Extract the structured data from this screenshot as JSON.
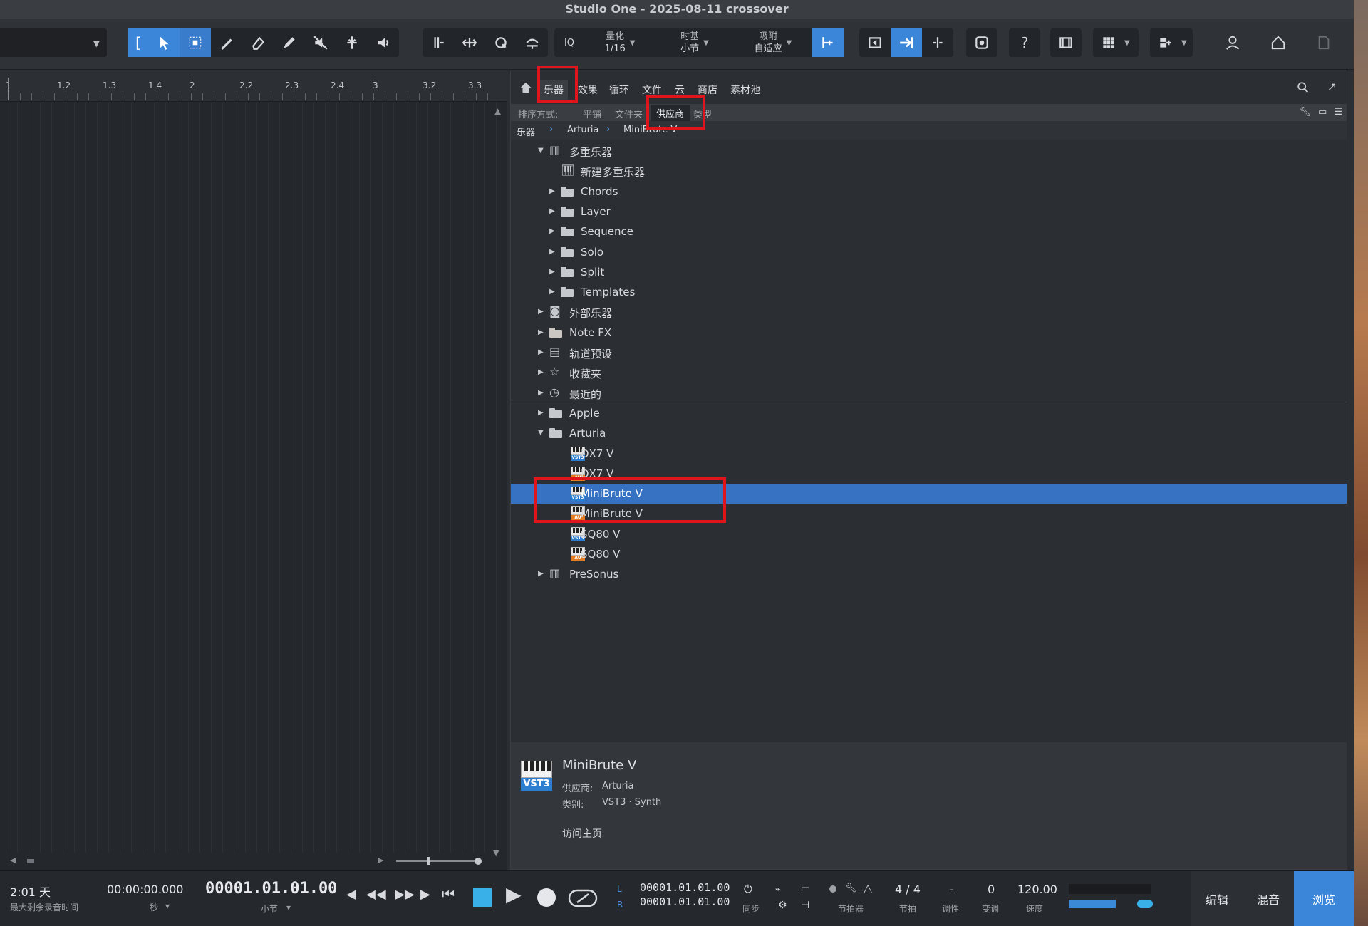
{
  "window": {
    "title": "Studio One - 2025-08-11 crossover"
  },
  "toolbar": {
    "iq_label": "IQ",
    "quantize": {
      "label": "量化",
      "value": "1/16"
    },
    "timebase": {
      "label": "时基",
      "value": "小节"
    },
    "snap": {
      "label": "吸附",
      "value": "自适应"
    },
    "help_label": "?"
  },
  "ruler": {
    "labels": [
      "1",
      "1.2",
      "1.3",
      "1.4",
      "2",
      "2.2",
      "2.3",
      "2.4",
      "3",
      "3.2",
      "3.3"
    ]
  },
  "browser": {
    "tabs": [
      "乐器",
      "效果",
      "循环",
      "文件",
      "云",
      "商店",
      "素材池"
    ],
    "selected_tab": "乐器",
    "sort": {
      "label": "排序方式:",
      "options": [
        "平铺",
        "文件夹",
        "供应商",
        "类型"
      ],
      "selected": "供应商"
    },
    "breadcrumb": [
      "乐器",
      "Arturia",
      "MiniBrute V"
    ],
    "tree": [
      {
        "label": "多重乐器",
        "depth": 0,
        "arrow": "down",
        "icon": "multi-instrument-icon"
      },
      {
        "label": "新建多重乐器",
        "depth": 1,
        "arrow": "",
        "icon": "piano-icon"
      },
      {
        "label": "Chords",
        "depth": 1,
        "arrow": "right",
        "icon": "folder-icon"
      },
      {
        "label": "Layer",
        "depth": 1,
        "arrow": "right",
        "icon": "folder-icon"
      },
      {
        "label": "Sequence",
        "depth": 1,
        "arrow": "right",
        "icon": "folder-icon"
      },
      {
        "label": "Solo",
        "depth": 1,
        "arrow": "right",
        "icon": "folder-icon"
      },
      {
        "label": "Split",
        "depth": 1,
        "arrow": "right",
        "icon": "folder-icon"
      },
      {
        "label": "Templates",
        "depth": 1,
        "arrow": "right",
        "icon": "folder-icon"
      },
      {
        "label": "外部乐器",
        "depth": 0,
        "arrow": "right",
        "icon": "camera-icon"
      },
      {
        "label": "Note FX",
        "depth": 0,
        "arrow": "right",
        "icon": "note-fx-folder-icon"
      },
      {
        "label": "轨道预设",
        "depth": 0,
        "arrow": "right",
        "icon": "track-preset-icon"
      },
      {
        "label": "收藏夹",
        "depth": 0,
        "arrow": "right",
        "icon": "star-icon"
      },
      {
        "label": "最近的",
        "depth": 0,
        "arrow": "right",
        "icon": "clock-icon"
      },
      {
        "label": "Apple",
        "depth": 0,
        "arrow": "right",
        "icon": "folder-icon",
        "divider_before": true
      },
      {
        "label": "Arturia",
        "depth": 0,
        "arrow": "down",
        "icon": "open-folder-icon"
      },
      {
        "label": "DX7 V",
        "depth": 1,
        "arrow": "",
        "icon": "vst3-plugin-icon",
        "format": "VST3"
      },
      {
        "label": "DX7 V",
        "depth": 1,
        "arrow": "",
        "icon": "au-plugin-icon",
        "format": "AU"
      },
      {
        "label": "MiniBrute V",
        "depth": 1,
        "arrow": "",
        "icon": "vst3-plugin-icon",
        "format": "VST3",
        "selected": true
      },
      {
        "label": "MiniBrute V",
        "depth": 1,
        "arrow": "",
        "icon": "au-plugin-icon",
        "format": "AU"
      },
      {
        "label": "SQ80 V",
        "depth": 1,
        "arrow": "",
        "icon": "vst3-plugin-icon",
        "format": "VST3"
      },
      {
        "label": "SQ80 V",
        "depth": 1,
        "arrow": "",
        "icon": "au-plugin-icon",
        "format": "AU"
      },
      {
        "label": "PreSonus",
        "depth": 0,
        "arrow": "right",
        "icon": "presonus-icon"
      }
    ],
    "detail": {
      "title": "MiniBrute V",
      "format_badge": "VST3",
      "vendor_label": "供应商:",
      "vendor_value": "Arturia",
      "category_label": "类别:",
      "category_value": "VST3 · Synth",
      "homepage_link": "访问主页"
    }
  },
  "transport": {
    "remaining": {
      "value": "2:01 天",
      "label": "最大剩余录音时间"
    },
    "seconds": {
      "value": "00:00:00.000",
      "label": "秒"
    },
    "position": {
      "value": "00001.01.01.00",
      "label": "小节"
    },
    "loop": {
      "l_marker": "L",
      "r_marker": "R",
      "left": "00001.01.01.00",
      "right": "00001.01.01.00"
    },
    "sync_label": "同步",
    "metronome_label": "节拍器",
    "signature": {
      "value": "4 / 4",
      "label": "节拍"
    },
    "key": {
      "value": "-",
      "label": "调性"
    },
    "transpose": {
      "value": "0",
      "label": "变调"
    },
    "tempo": {
      "value": "120.00",
      "label": "速度"
    },
    "views": [
      "编辑",
      "混音",
      "浏览"
    ],
    "active_view": "浏览"
  },
  "colors": {
    "accent": "#3c86d9",
    "selection": "#3771c2",
    "highlight": "#e0141b"
  }
}
